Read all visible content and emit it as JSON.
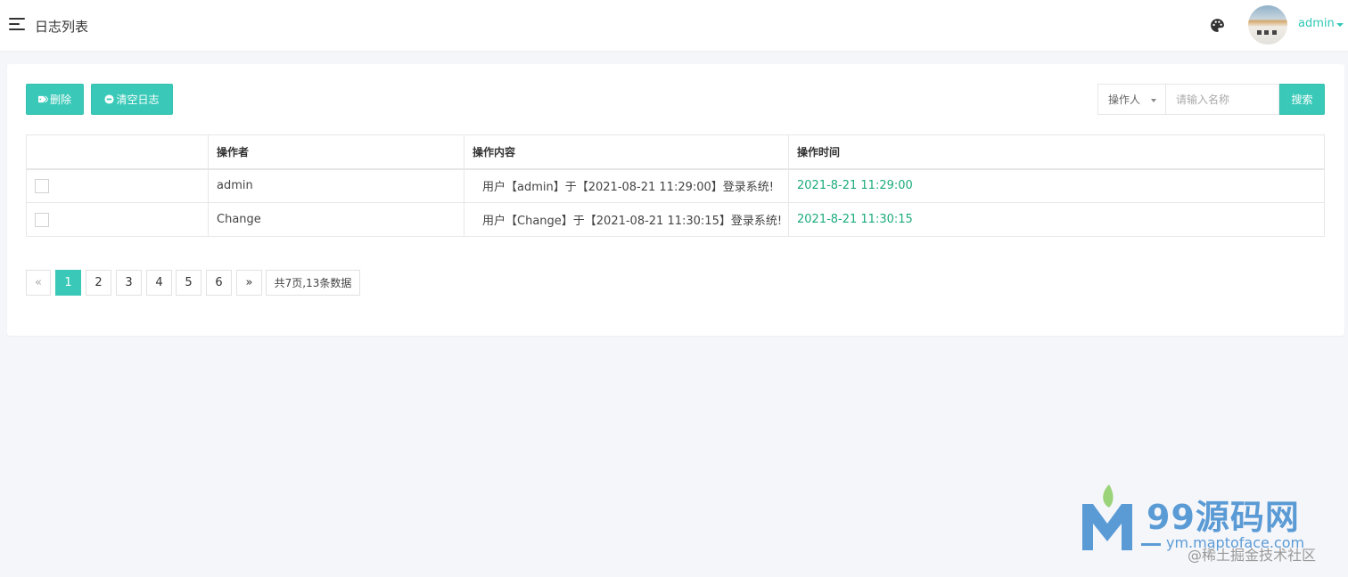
{
  "header": {
    "title": "日志列表",
    "user_name": "admin"
  },
  "toolbar": {
    "delete_label": "删除",
    "clear_label": "清空日志",
    "search_select": "操作人",
    "search_placeholder": "请输入名称",
    "search_button": "搜索"
  },
  "table": {
    "headers": [
      "",
      "操作者",
      "操作内容",
      "操作时间"
    ],
    "rows": [
      {
        "operator": "admin",
        "content": "用户【admin】于【2021-08-21 11:29:00】登录系统!",
        "time": "2021-8-21 11:29:00"
      },
      {
        "operator": "Change",
        "content": "用户【Change】于【2021-08-21 11:30:15】登录系统!",
        "time": "2021-8-21 11:30:15"
      }
    ]
  },
  "pagination": {
    "prev": "«",
    "pages": [
      "1",
      "2",
      "3",
      "4",
      "5",
      "6"
    ],
    "current": "1",
    "next": "»",
    "summary": "共7页,13条数据"
  },
  "watermark": {
    "site": "99源码网",
    "url": "ym.maptoface.com",
    "juejin": "@稀土掘金技术社区"
  },
  "colors": {
    "accent": "#3ac9b8",
    "time_green": "#1cab7d",
    "link": "#2ec7b7"
  },
  "icons": {
    "menu": "hamburger-menu-icon",
    "theme": "palette-icon",
    "delete": "tag-icon",
    "clear": "minus-circle-icon"
  }
}
